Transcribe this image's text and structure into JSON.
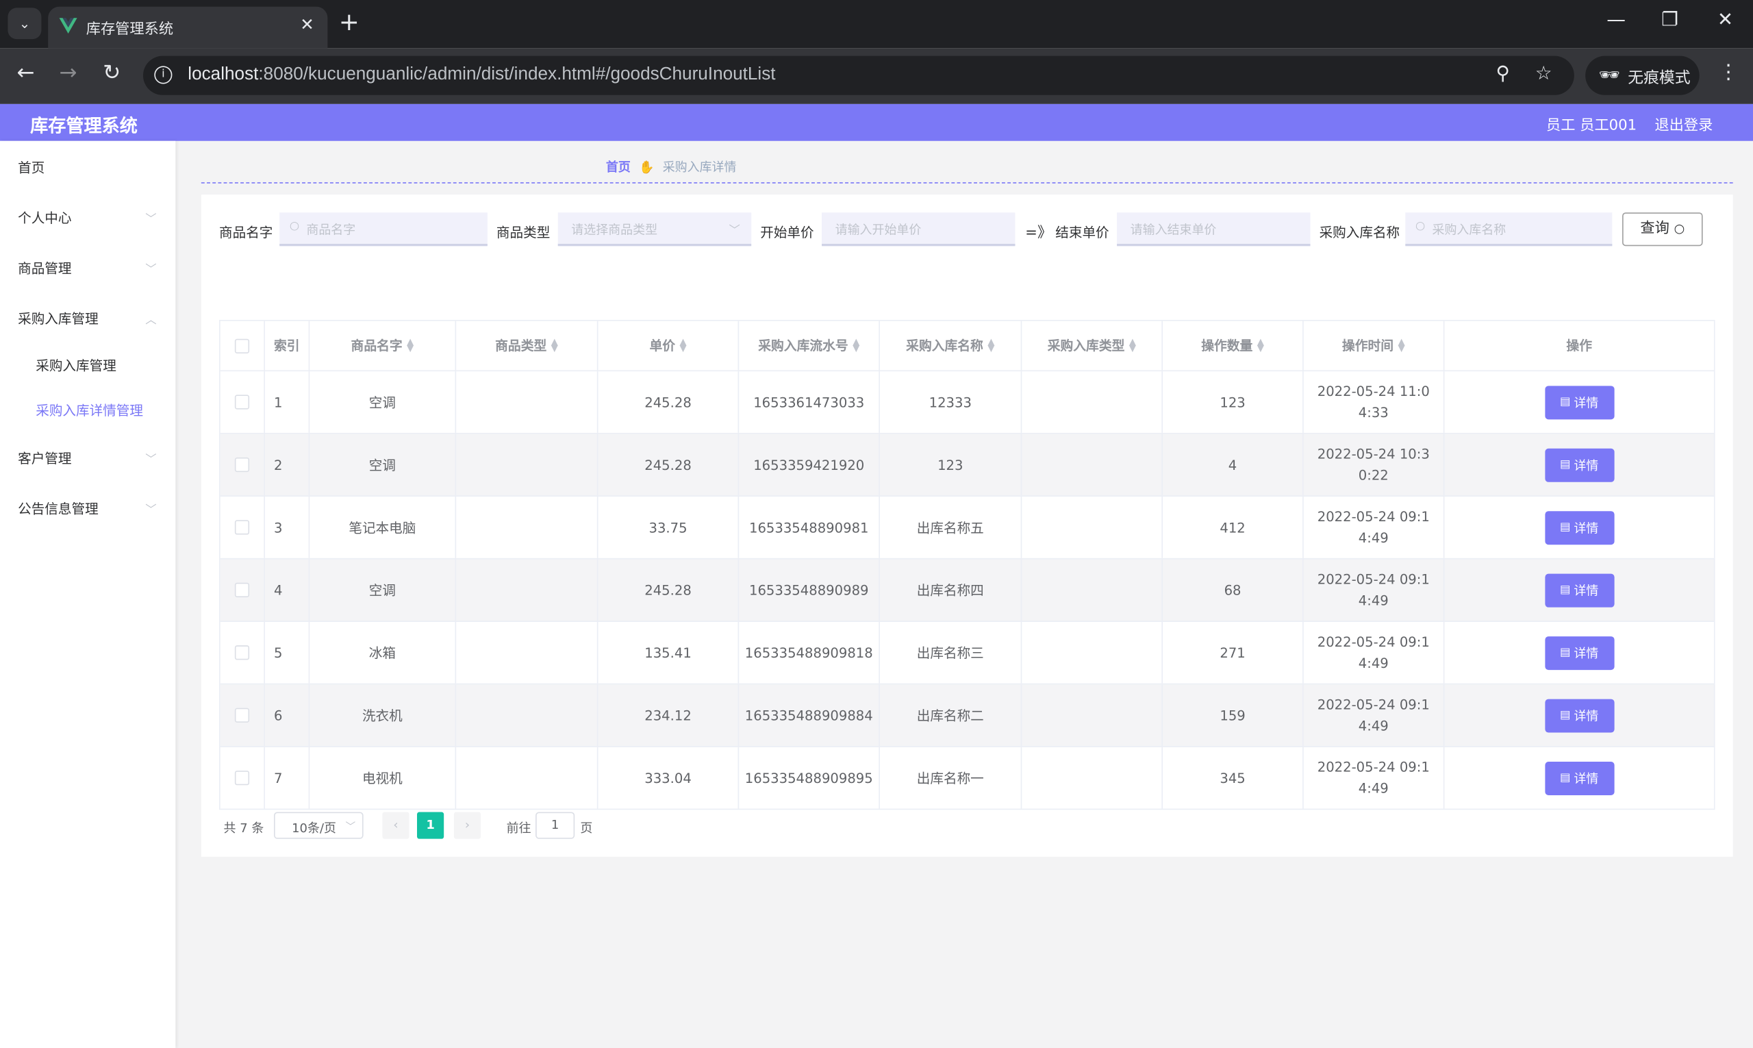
{
  "browser": {
    "tab_title": "库存管理系统",
    "url_host": "localhost",
    "url_path": ":8080/kucuenguanlic/admin/dist/index.html#/goodsChuruInoutList",
    "incognito_label": "无痕模式"
  },
  "header": {
    "title": "库存管理系统",
    "user": "员工 员工001",
    "logout": "退出登录"
  },
  "sidebar": {
    "items": [
      {
        "label": "首页"
      },
      {
        "label": "个人中心"
      },
      {
        "label": "商品管理"
      },
      {
        "label": "采购入库管理"
      },
      {
        "label": "采购入库管理"
      },
      {
        "label": "采购入库详情管理"
      },
      {
        "label": "客户管理"
      },
      {
        "label": "公告信息管理"
      }
    ]
  },
  "breadcrumb": {
    "home": "首页",
    "current": "采购入库详情"
  },
  "search": {
    "name_label": "商品名字",
    "name_placeholder": "商品名字",
    "type_label": "商品类型",
    "type_placeholder": "请选择商品类型",
    "start_label": "开始单价",
    "start_placeholder": "请输入开始单价",
    "separator": "=》",
    "end_label": "结束单价",
    "end_placeholder": "请输入结束单价",
    "inout_label": "采购入库名称",
    "inout_placeholder": "采购入库名称",
    "query_button": "查询"
  },
  "table": {
    "columns": [
      "索引",
      "商品名字",
      "商品类型",
      "单价",
      "采购入库流水号",
      "采购入库名称",
      "采购入库类型",
      "操作数量",
      "操作时间",
      "操作"
    ],
    "detail_label": "详情",
    "rows": [
      {
        "idx": "1",
        "name": "空调",
        "type": "",
        "price": "245.28",
        "serial": "1653361473033",
        "inout": "12333",
        "inout_type": "",
        "qty": "123",
        "time": "2022-05-24 11:04:33"
      },
      {
        "idx": "2",
        "name": "空调",
        "type": "",
        "price": "245.28",
        "serial": "1653359421920",
        "inout": "123",
        "inout_type": "",
        "qty": "4",
        "time": "2022-05-24 10:30:22"
      },
      {
        "idx": "3",
        "name": "笔记本电脑",
        "type": "",
        "price": "33.75",
        "serial": "16533548890981",
        "inout": "出库名称五",
        "inout_type": "",
        "qty": "412",
        "time": "2022-05-24 09:14:49"
      },
      {
        "idx": "4",
        "name": "空调",
        "type": "",
        "price": "245.28",
        "serial": "16533548890989",
        "inout": "出库名称四",
        "inout_type": "",
        "qty": "68",
        "time": "2022-05-24 09:14:49"
      },
      {
        "idx": "5",
        "name": "冰箱",
        "type": "",
        "price": "135.41",
        "serial": "165335488909818",
        "inout": "出库名称三",
        "inout_type": "",
        "qty": "271",
        "time": "2022-05-24 09:14:49"
      },
      {
        "idx": "6",
        "name": "洗衣机",
        "type": "",
        "price": "234.12",
        "serial": "165335488909884",
        "inout": "出库名称二",
        "inout_type": "",
        "qty": "159",
        "time": "2022-05-24 09:14:49"
      },
      {
        "idx": "7",
        "name": "电视机",
        "type": "",
        "price": "333.04",
        "serial": "165335488909895",
        "inout": "出库名称一",
        "inout_type": "",
        "qty": "345",
        "time": "2022-05-24 09:14:49"
      }
    ]
  },
  "pagination": {
    "total": "共 7 条",
    "page_size": "10条/页",
    "current": "1",
    "goto_label": "前往",
    "goto_value": "1",
    "page_suffix": "页"
  },
  "colors": {
    "accent": "#7b78f6",
    "page_active": "#13c2a3"
  }
}
